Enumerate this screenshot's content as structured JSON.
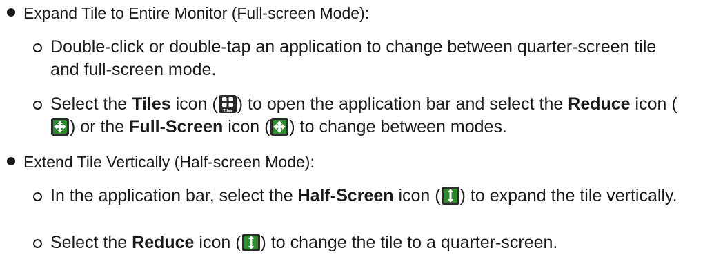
{
  "items": [
    {
      "heading": "Expand Tile to Entire Monitor (Full-screen Mode):",
      "subitems": [
        {
          "text": "Double-click or double-tap an application to change between quarter-screen tile and full-screen mode."
        },
        {
          "t1": "Select the ",
          "b1": "Tiles",
          "t2": " icon (",
          "icon1": "tiles-icon",
          "t3": ") to open the application bar and select the ",
          "b2": "Reduce",
          "t4": " icon (",
          "icon2": "reduce-fullscreen-icon",
          "t5": ") or the ",
          "b3": "Full-Screen",
          "t6": " icon (",
          "icon3": "full-screen-icon",
          "t7": ") to change between modes."
        }
      ]
    },
    {
      "heading": "Extend Tile Vertically (Half-screen Mode):",
      "subitems": [
        {
          "t1": "In the application bar, select the ",
          "b1": "Half-Screen",
          "t2": " icon (",
          "icon1": "half-screen-icon",
          "t3": ") to expand the tile vertically."
        },
        {
          "t1": "Select the ",
          "b1": "Reduce",
          "t2": " icon (",
          "icon1": "reduce-halfscreen-icon",
          "t3": ") to change the tile to a quarter-screen."
        }
      ]
    }
  ],
  "icons": {
    "tiles_label": "Tiles"
  },
  "colors": {
    "icon_dark": "#2b2b2b",
    "icon_green": "#2e8b2e",
    "text": "#1a1a1a"
  }
}
